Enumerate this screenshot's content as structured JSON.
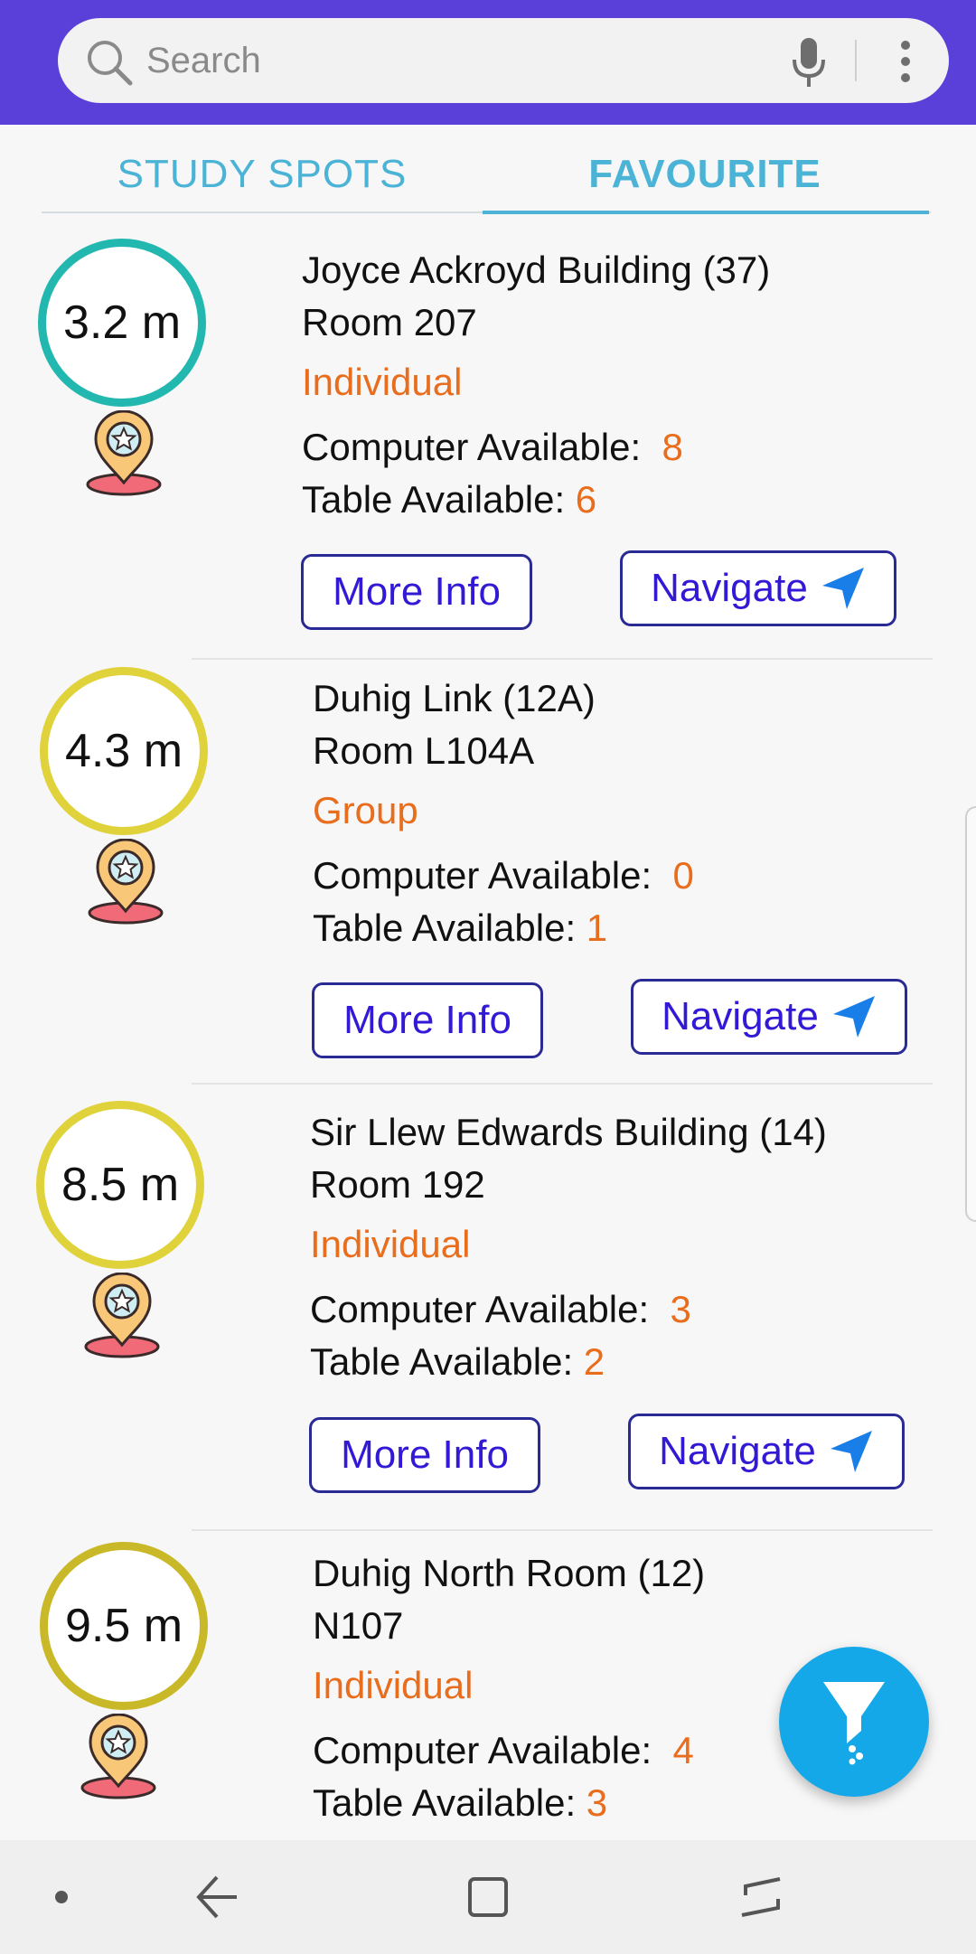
{
  "search": {
    "placeholder": "Search"
  },
  "tabs": [
    {
      "label": "STUDY SPOTS",
      "selected": false
    },
    {
      "label": "FAVOURITE",
      "selected": true
    }
  ],
  "labels": {
    "computer": "Computer Available:",
    "table": "Table Available:",
    "more_info": "More Info",
    "navigate": "Navigate"
  },
  "spots": [
    {
      "distance": "3.2 m",
      "ring_color": "#22b8b0",
      "building": "Joyce Ackroyd Building (37)",
      "room": "Room 207",
      "type": "Individual",
      "computers": "8",
      "tables": "6"
    },
    {
      "distance": "4.3 m",
      "ring_color": "#e0d23a",
      "building": "Duhig Link (12A)",
      "room": "Room L104A",
      "type": "Group",
      "computers": "0",
      "tables": "1"
    },
    {
      "distance": "8.5 m",
      "ring_color": "#e0d23a",
      "building": "Sir Llew Edwards Building (14)",
      "room": "Room 192",
      "type": "Individual",
      "computers": "3",
      "tables": "2"
    },
    {
      "distance": "9.5 m",
      "ring_color": "#c9b928",
      "building": "Duhig North Room (12)",
      "room": "N107",
      "type": "Individual",
      "computers": "4",
      "tables": "3"
    }
  ],
  "colors": {
    "header": "#5a3fd9",
    "accent": "#4ab3d6",
    "value": "#e86d1c",
    "button_text": "#3219d6",
    "fab": "#15a8e8"
  },
  "icons": [
    "search-icon",
    "microphone-icon",
    "more-vert-icon",
    "location-star-pin-icon",
    "navigate-arrow-icon",
    "filter-icon"
  ]
}
